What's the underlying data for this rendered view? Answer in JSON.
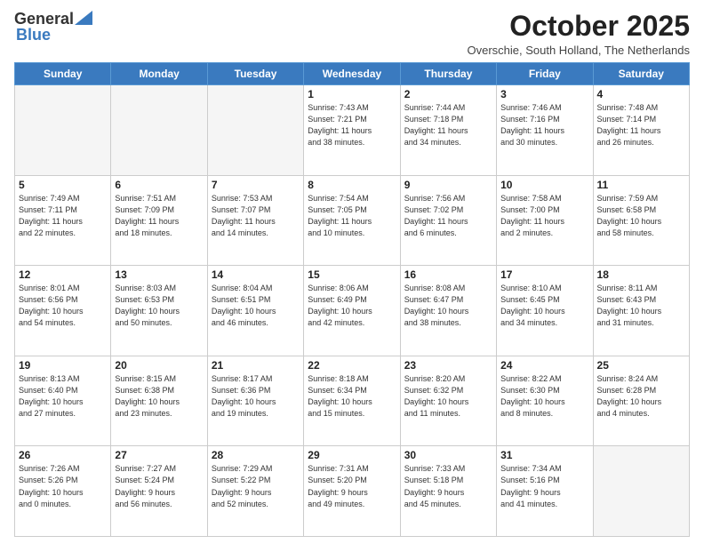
{
  "header": {
    "logo_general": "General",
    "logo_blue": "Blue",
    "month_title": "October 2025",
    "location": "Overschie, South Holland, The Netherlands"
  },
  "days_of_week": [
    "Sunday",
    "Monday",
    "Tuesday",
    "Wednesday",
    "Thursday",
    "Friday",
    "Saturday"
  ],
  "weeks": [
    [
      {
        "day": "",
        "info": ""
      },
      {
        "day": "",
        "info": ""
      },
      {
        "day": "",
        "info": ""
      },
      {
        "day": "1",
        "info": "Sunrise: 7:43 AM\nSunset: 7:21 PM\nDaylight: 11 hours\nand 38 minutes."
      },
      {
        "day": "2",
        "info": "Sunrise: 7:44 AM\nSunset: 7:18 PM\nDaylight: 11 hours\nand 34 minutes."
      },
      {
        "day": "3",
        "info": "Sunrise: 7:46 AM\nSunset: 7:16 PM\nDaylight: 11 hours\nand 30 minutes."
      },
      {
        "day": "4",
        "info": "Sunrise: 7:48 AM\nSunset: 7:14 PM\nDaylight: 11 hours\nand 26 minutes."
      }
    ],
    [
      {
        "day": "5",
        "info": "Sunrise: 7:49 AM\nSunset: 7:11 PM\nDaylight: 11 hours\nand 22 minutes."
      },
      {
        "day": "6",
        "info": "Sunrise: 7:51 AM\nSunset: 7:09 PM\nDaylight: 11 hours\nand 18 minutes."
      },
      {
        "day": "7",
        "info": "Sunrise: 7:53 AM\nSunset: 7:07 PM\nDaylight: 11 hours\nand 14 minutes."
      },
      {
        "day": "8",
        "info": "Sunrise: 7:54 AM\nSunset: 7:05 PM\nDaylight: 11 hours\nand 10 minutes."
      },
      {
        "day": "9",
        "info": "Sunrise: 7:56 AM\nSunset: 7:02 PM\nDaylight: 11 hours\nand 6 minutes."
      },
      {
        "day": "10",
        "info": "Sunrise: 7:58 AM\nSunset: 7:00 PM\nDaylight: 11 hours\nand 2 minutes."
      },
      {
        "day": "11",
        "info": "Sunrise: 7:59 AM\nSunset: 6:58 PM\nDaylight: 10 hours\nand 58 minutes."
      }
    ],
    [
      {
        "day": "12",
        "info": "Sunrise: 8:01 AM\nSunset: 6:56 PM\nDaylight: 10 hours\nand 54 minutes."
      },
      {
        "day": "13",
        "info": "Sunrise: 8:03 AM\nSunset: 6:53 PM\nDaylight: 10 hours\nand 50 minutes."
      },
      {
        "day": "14",
        "info": "Sunrise: 8:04 AM\nSunset: 6:51 PM\nDaylight: 10 hours\nand 46 minutes."
      },
      {
        "day": "15",
        "info": "Sunrise: 8:06 AM\nSunset: 6:49 PM\nDaylight: 10 hours\nand 42 minutes."
      },
      {
        "day": "16",
        "info": "Sunrise: 8:08 AM\nSunset: 6:47 PM\nDaylight: 10 hours\nand 38 minutes."
      },
      {
        "day": "17",
        "info": "Sunrise: 8:10 AM\nSunset: 6:45 PM\nDaylight: 10 hours\nand 34 minutes."
      },
      {
        "day": "18",
        "info": "Sunrise: 8:11 AM\nSunset: 6:43 PM\nDaylight: 10 hours\nand 31 minutes."
      }
    ],
    [
      {
        "day": "19",
        "info": "Sunrise: 8:13 AM\nSunset: 6:40 PM\nDaylight: 10 hours\nand 27 minutes."
      },
      {
        "day": "20",
        "info": "Sunrise: 8:15 AM\nSunset: 6:38 PM\nDaylight: 10 hours\nand 23 minutes."
      },
      {
        "day": "21",
        "info": "Sunrise: 8:17 AM\nSunset: 6:36 PM\nDaylight: 10 hours\nand 19 minutes."
      },
      {
        "day": "22",
        "info": "Sunrise: 8:18 AM\nSunset: 6:34 PM\nDaylight: 10 hours\nand 15 minutes."
      },
      {
        "day": "23",
        "info": "Sunrise: 8:20 AM\nSunset: 6:32 PM\nDaylight: 10 hours\nand 11 minutes."
      },
      {
        "day": "24",
        "info": "Sunrise: 8:22 AM\nSunset: 6:30 PM\nDaylight: 10 hours\nand 8 minutes."
      },
      {
        "day": "25",
        "info": "Sunrise: 8:24 AM\nSunset: 6:28 PM\nDaylight: 10 hours\nand 4 minutes."
      }
    ],
    [
      {
        "day": "26",
        "info": "Sunrise: 7:26 AM\nSunset: 5:26 PM\nDaylight: 10 hours\nand 0 minutes."
      },
      {
        "day": "27",
        "info": "Sunrise: 7:27 AM\nSunset: 5:24 PM\nDaylight: 9 hours\nand 56 minutes."
      },
      {
        "day": "28",
        "info": "Sunrise: 7:29 AM\nSunset: 5:22 PM\nDaylight: 9 hours\nand 52 minutes."
      },
      {
        "day": "29",
        "info": "Sunrise: 7:31 AM\nSunset: 5:20 PM\nDaylight: 9 hours\nand 49 minutes."
      },
      {
        "day": "30",
        "info": "Sunrise: 7:33 AM\nSunset: 5:18 PM\nDaylight: 9 hours\nand 45 minutes."
      },
      {
        "day": "31",
        "info": "Sunrise: 7:34 AM\nSunset: 5:16 PM\nDaylight: 9 hours\nand 41 minutes."
      },
      {
        "day": "",
        "info": ""
      }
    ]
  ]
}
